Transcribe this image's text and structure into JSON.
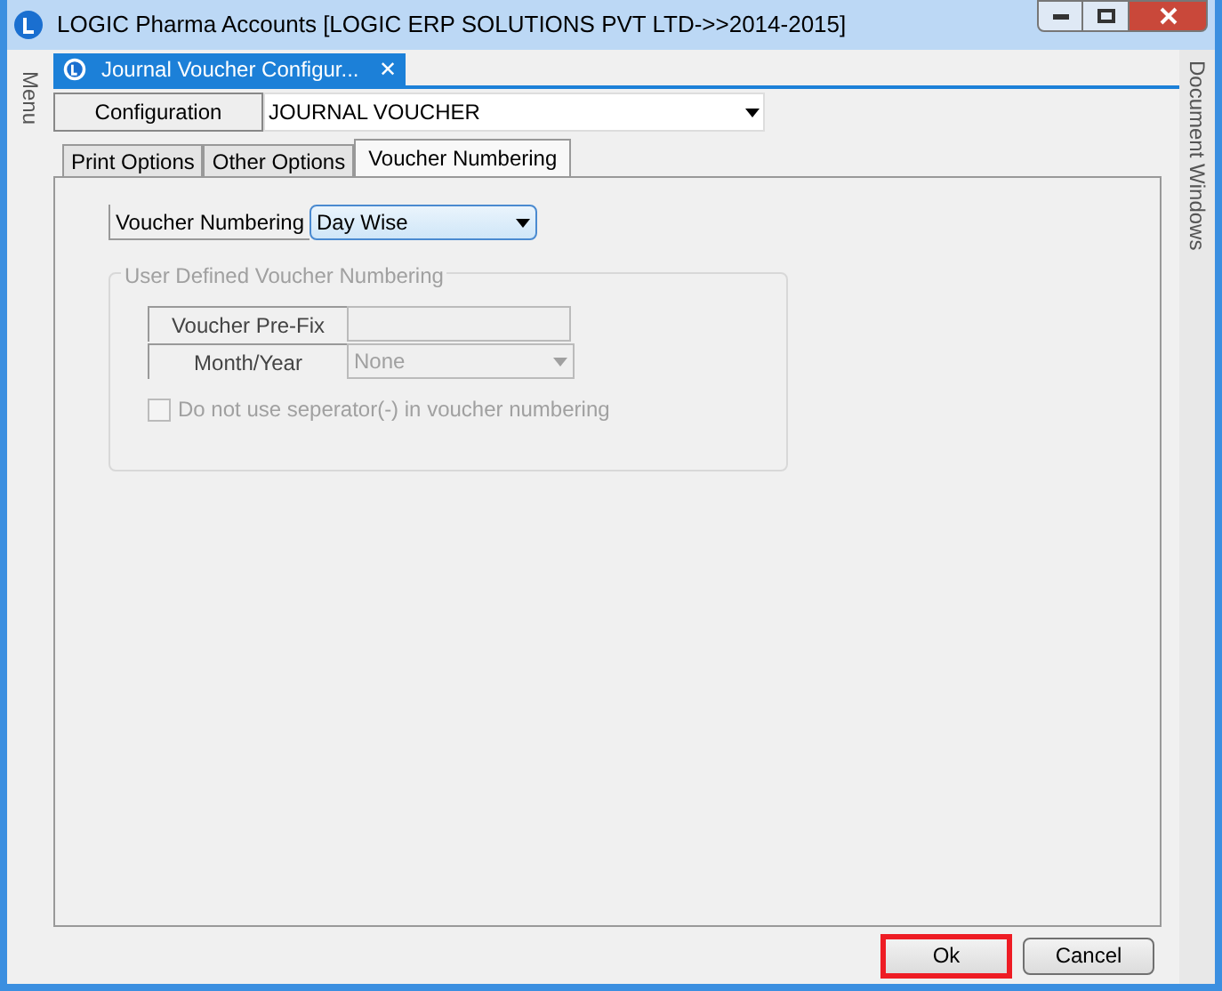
{
  "window": {
    "title": "LOGIC Pharma Accounts  [LOGIC ERP SOLUTIONS PVT LTD->>2014-2015]"
  },
  "side_panels": {
    "left": "Menu",
    "right": "Document Windows"
  },
  "document_tab": {
    "title": "Journal Voucher Configur...",
    "close": "✕"
  },
  "configuration": {
    "label": "Configuration",
    "value": "JOURNAL VOUCHER"
  },
  "tabs": [
    {
      "label": "Print Options",
      "selected": false
    },
    {
      "label": "Other Options",
      "selected": false
    },
    {
      "label": "Voucher Numbering",
      "selected": true
    }
  ],
  "voucher_numbering": {
    "label": "Voucher Numbering",
    "value": "Day Wise"
  },
  "user_defined_group": {
    "title": "User Defined Voucher Numbering",
    "disabled": true,
    "prefix": {
      "label": "Voucher Pre-Fix"
    },
    "month_year": {
      "label": "Month/Year",
      "value": "None"
    },
    "separator_checkbox": {
      "label": "Do not use seperator(-) in voucher numbering",
      "checked": false
    }
  },
  "buttons": [
    {
      "label": "Ok",
      "highlighted": true
    },
    {
      "label": "Cancel",
      "highlighted": false
    }
  ]
}
